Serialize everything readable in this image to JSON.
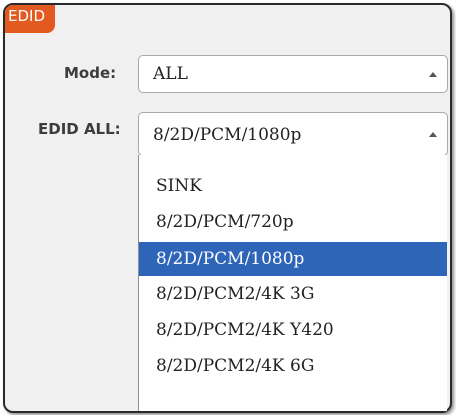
{
  "panel": {
    "title": "EDID"
  },
  "mode": {
    "label": "Mode:",
    "value": "ALL"
  },
  "edid_all": {
    "label": "EDID ALL:",
    "value": "8/2D/PCM/1080p",
    "options": [
      "SINK",
      "8/2D/PCM/720p",
      "8/2D/PCM/1080p",
      "8/2D/PCM2/4K 3G",
      "8/2D/PCM2/4K Y420",
      "8/2D/PCM2/4K 6G"
    ],
    "selected_index": 2
  },
  "colors": {
    "tab": "#e35a21",
    "highlight": "#2f65b9",
    "panel_bg": "#f0f0f0"
  }
}
